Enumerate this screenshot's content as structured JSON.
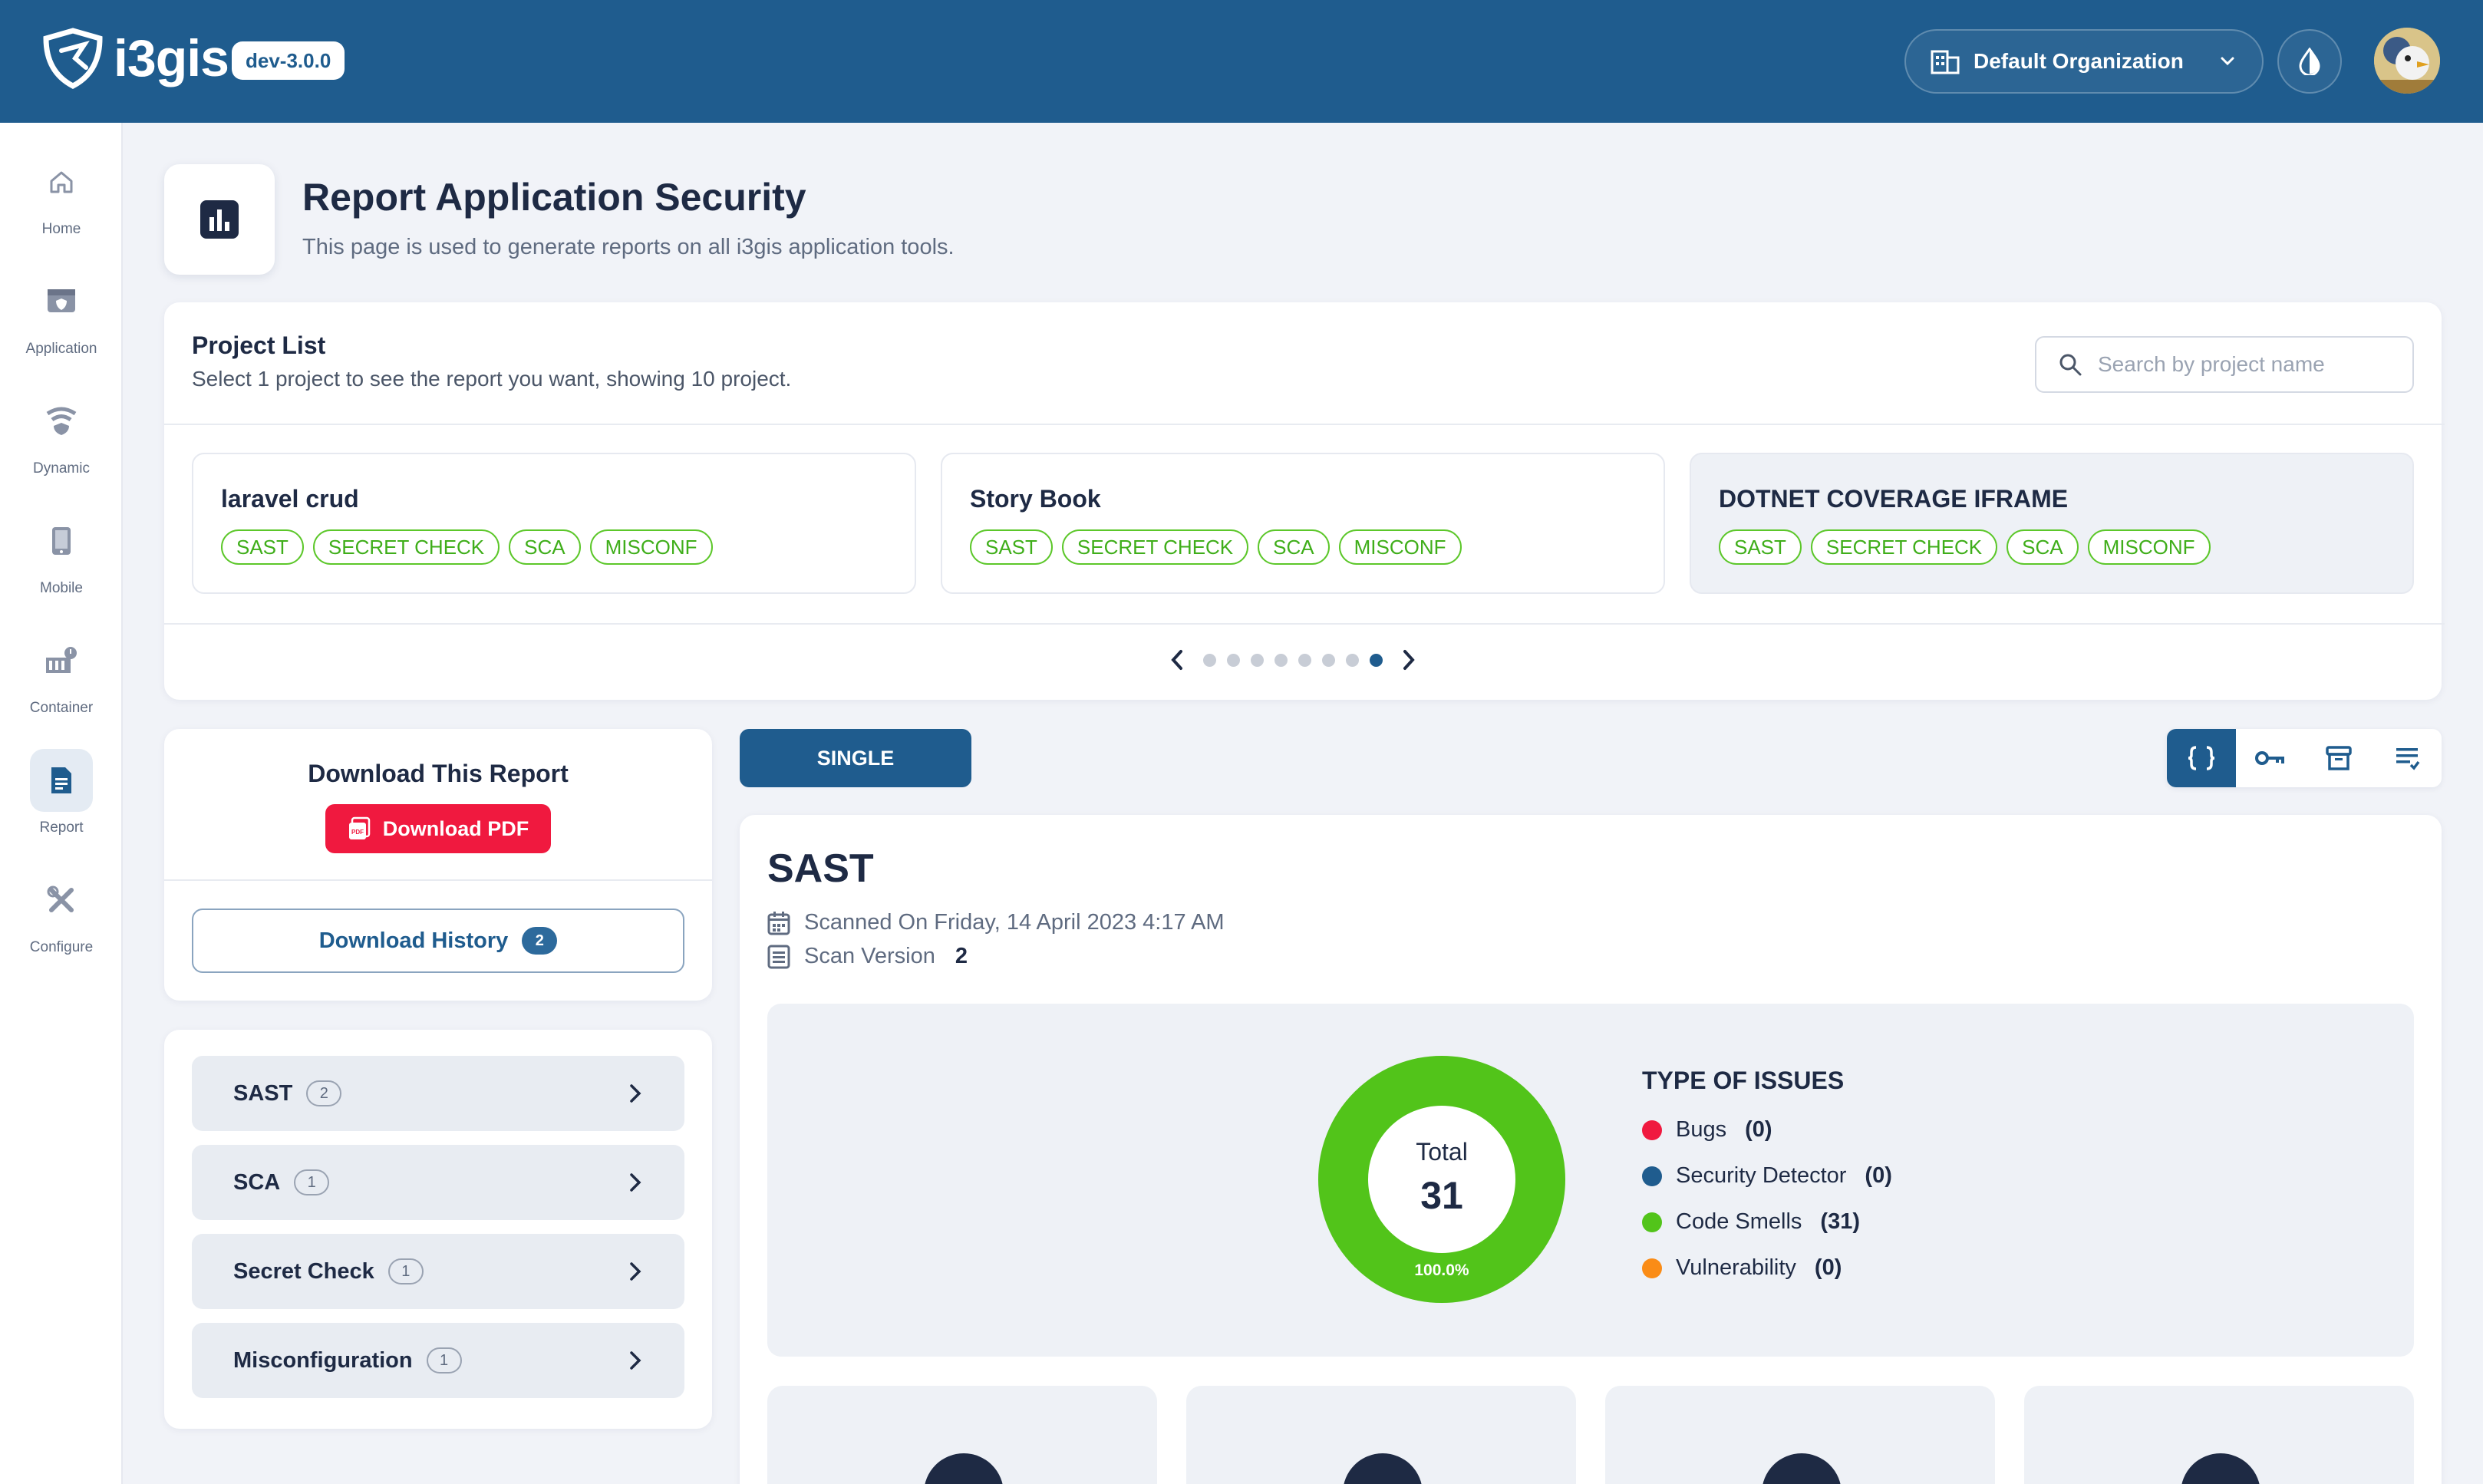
{
  "header": {
    "logo_text": "i3gis",
    "version": "dev-3.0.0",
    "organization": "Default Organization"
  },
  "sidebar": {
    "items": [
      {
        "label": "Home",
        "icon": "home-icon"
      },
      {
        "label": "Application",
        "icon": "application-icon"
      },
      {
        "label": "Dynamic",
        "icon": "wifi-shield-icon"
      },
      {
        "label": "Mobile",
        "icon": "mobile-icon"
      },
      {
        "label": "Container",
        "icon": "container-icon"
      },
      {
        "label": "Report",
        "icon": "report-icon",
        "active": true
      },
      {
        "label": "Configure",
        "icon": "tools-icon"
      }
    ]
  },
  "page": {
    "title": "Report Application Security",
    "subtitle": "This page is used to generate reports on all i3gis application tools."
  },
  "project_list": {
    "title": "Project List",
    "subtitle": "Select 1 project to see the report you want, showing 10 project.",
    "search_placeholder": "Search by project name",
    "projects": [
      {
        "name": "laravel crud",
        "tags": [
          "SAST",
          "SECRET CHECK",
          "SCA",
          "MISCONF"
        ]
      },
      {
        "name": "Story Book",
        "tags": [
          "SAST",
          "SECRET CHECK",
          "SCA",
          "MISCONF"
        ]
      },
      {
        "name": "DOTNET COVERAGE IFRAME",
        "tags": [
          "SAST",
          "SECRET CHECK",
          "SCA",
          "MISCONF"
        ],
        "selected": true
      }
    ],
    "pager": {
      "pages": 8,
      "active_page": 8
    }
  },
  "download": {
    "title": "Download This Report",
    "pdf_label": "Download PDF",
    "history_label": "Download History",
    "history_count": "2"
  },
  "tools": [
    {
      "label": "SAST",
      "count": "2"
    },
    {
      "label": "SCA",
      "count": "1"
    },
    {
      "label": "Secret Check",
      "count": "1"
    },
    {
      "label": "Misconfiguration",
      "count": "1"
    }
  ],
  "view_toggle": {
    "mode_label": "SINGLE",
    "buttons": [
      "code-braces-icon",
      "key-icon",
      "archive-icon",
      "list-icon"
    ],
    "active": 0
  },
  "report": {
    "title": "SAST",
    "scanned_on": "Scanned On Friday, 14 April 2023 4:17 AM",
    "scan_version_label": "Scan Version",
    "scan_version": "2"
  },
  "chart_data": {
    "type": "pie",
    "title": "TYPE OF ISSUES",
    "center_label": "Total",
    "total": 31,
    "percent_label": "100.0%",
    "series": [
      {
        "name": "Bugs",
        "value": 0,
        "display": "(0)",
        "color": "#f0193f"
      },
      {
        "name": "Security Detector",
        "value": 0,
        "display": "(0)",
        "color": "#1f5c8e"
      },
      {
        "name": "Code Smells",
        "value": 31,
        "display": "(31)",
        "color": "#52c41a"
      },
      {
        "name": "Vulnerability",
        "value": 0,
        "display": "(0)",
        "color": "#fa8c16"
      }
    ]
  },
  "colors": {
    "primary": "#1f5c8e",
    "danger": "#f0193f",
    "success": "#52c41a",
    "warning": "#fa8c16"
  }
}
